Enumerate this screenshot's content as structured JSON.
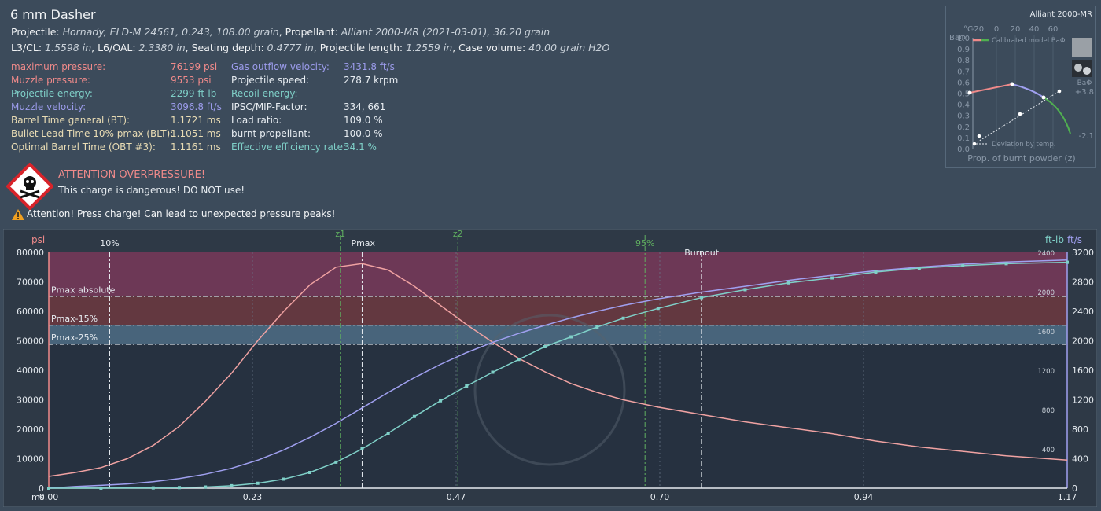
{
  "header": {
    "title": "6 mm Dasher",
    "line1": [
      {
        "t": "Projectile: ",
        "i": false
      },
      {
        "t": "Hornady, ELD-M 24561, 0.243, 108.00 grain",
        "i": true
      },
      {
        "t": ", Propellant: ",
        "i": false
      },
      {
        "t": "Alliant 2000-MR (2021-03-01), 36.20 grain",
        "i": true
      }
    ],
    "line2": [
      {
        "t": "L3/CL: ",
        "i": false
      },
      {
        "t": "1.5598 in",
        "i": true
      },
      {
        "t": ", L6/OAL: ",
        "i": false
      },
      {
        "t": "2.3380 in",
        "i": true
      },
      {
        "t": ", Seating depth: ",
        "i": false
      },
      {
        "t": "0.4777 in",
        "i": true
      },
      {
        "t": ", Projectile length: ",
        "i": false
      },
      {
        "t": "1.2559 in",
        "i": true
      },
      {
        "t": ", Case volume: ",
        "i": false
      },
      {
        "t": "40.00 grain H2O",
        "i": true
      }
    ]
  },
  "results_left": [
    {
      "label": "maximum pressure:",
      "value": "76199 psi",
      "color": "red"
    },
    {
      "label": "Muzzle pressure:",
      "value": "9553 psi",
      "color": "red"
    },
    {
      "label": "Projectile energy:",
      "value": "2299 ft-lb",
      "color": "teal"
    },
    {
      "label": "Muzzle velocity:",
      "value": "3096.8 ft/s",
      "color": "blue"
    },
    {
      "label": "Barrel Time general (BT):",
      "value": "1.1721 ms",
      "color": "beige"
    },
    {
      "label": "Bullet Lead Time 10% pmax (BLT):",
      "value": "1.1051 ms",
      "color": "beige"
    },
    {
      "label": "Optimal Barrel Time (OBT #3):",
      "value": "1.1161 ms",
      "color": "beige"
    }
  ],
  "results_right": [
    {
      "label": "Gas outflow velocity:",
      "value": "3431.8 ft/s",
      "color": "blue"
    },
    {
      "label": "Projectile speed:",
      "value": "278.7 krpm",
      "color": "white"
    },
    {
      "label": "Recoil energy:",
      "value": "-",
      "color": "teal"
    },
    {
      "label": "IPSC/MIP-Factor:",
      "value": "334, 661",
      "color": "white"
    },
    {
      "label": "Load ratio:",
      "value": "109.0 %",
      "color": "white"
    },
    {
      "label": "burnt propellant:",
      "value": "100.0 %",
      "color": "white"
    },
    {
      "label": "Effective efficiency rate:",
      "value": "34.1 %",
      "color": "teal"
    }
  ],
  "warnings": {
    "overpressure_title": "ATTENTION OVERPRESSURE!",
    "overpressure_text": "This charge is dangerous! DO NOT use!",
    "press_charge": "Attention! Press charge! Can lead to unexpected pressure peaks!"
  },
  "inset": {
    "title": "Alliant 2000-MR",
    "y_label": "BaΦ",
    "top_axis_label": "°C",
    "top_axis_ticks": [
      "-20",
      "0",
      "20",
      "40",
      "60"
    ],
    "y_ticks": [
      "1.0",
      "0.9",
      "0.8",
      "0.7",
      "0.6",
      "0.5",
      "0.4",
      "0.3",
      "0.2",
      "0.1",
      "0.0"
    ],
    "right_ticks": [
      "+3.8",
      "-2.1"
    ],
    "legend_calibrated": "Calibrated model BaΦ",
    "legend_deviation": "Deviation by temp.",
    "x_label": "Prop. of burnt powder (z)",
    "side_label": "BaΦ"
  },
  "chart_data": {
    "type": "line",
    "x_unit": "ms",
    "x_ticks": [
      "0.00",
      "0.23",
      "0.47",
      "0.70",
      "0.94",
      "1.17"
    ],
    "x_range": [
      0,
      1.17
    ],
    "y_left_unit": "psi",
    "y_left_ticks": [
      "0",
      "10000",
      "20000",
      "30000",
      "40000",
      "50000",
      "60000",
      "70000",
      "80000"
    ],
    "y_left_range": [
      0,
      80000
    ],
    "y_right_velocity_unit": "ft/s",
    "y_right_velocity_ticks": [
      "0",
      "400",
      "800",
      "1200",
      "1600",
      "2000",
      "2400",
      "2800",
      "3200"
    ],
    "y_right_velocity_range": [
      0,
      3200
    ],
    "y_right_energy_unit": "ft-lb",
    "y_right_energy_ticks": [
      "400",
      "800",
      "1200",
      "1600",
      "2000",
      "2400"
    ],
    "y_right_energy_range": [
      0,
      2400
    ],
    "markers": [
      {
        "label": "10%",
        "x": 0.07,
        "style": "white"
      },
      {
        "label": "z1",
        "x": 0.335,
        "style": "green"
      },
      {
        "label": "Pmax",
        "x": 0.36,
        "style": "white"
      },
      {
        "label": "z2",
        "x": 0.47,
        "style": "green"
      },
      {
        "label": "95%",
        "x": 0.685,
        "style": "green"
      },
      {
        "label": "Burnout",
        "x": 0.75,
        "style": "white"
      }
    ],
    "zones": [
      {
        "label": "Pmax absolute",
        "value": 65000,
        "color": "#7a3a5a"
      },
      {
        "label": "Pmax-15%",
        "value": 55250,
        "color": "#6a3a40"
      },
      {
        "label": "Pmax-25%",
        "value": 48750,
        "color": "#4d6a82"
      }
    ],
    "series": [
      {
        "name": "pressure",
        "unit": "psi",
        "color": "#f0a2a2",
        "points": [
          [
            0,
            4000
          ],
          [
            0.03,
            5300
          ],
          [
            0.06,
            7000
          ],
          [
            0.09,
            10000
          ],
          [
            0.12,
            14500
          ],
          [
            0.15,
            21000
          ],
          [
            0.18,
            29500
          ],
          [
            0.21,
            39000
          ],
          [
            0.24,
            50000
          ],
          [
            0.27,
            60000
          ],
          [
            0.3,
            69000
          ],
          [
            0.33,
            75000
          ],
          [
            0.36,
            76199
          ],
          [
            0.39,
            74000
          ],
          [
            0.42,
            68500
          ],
          [
            0.45,
            62000
          ],
          [
            0.48,
            55500
          ],
          [
            0.51,
            49500
          ],
          [
            0.54,
            44000
          ],
          [
            0.57,
            39500
          ],
          [
            0.6,
            35500
          ],
          [
            0.63,
            32500
          ],
          [
            0.66,
            30000
          ],
          [
            0.7,
            27500
          ],
          [
            0.75,
            25000
          ],
          [
            0.8,
            22500
          ],
          [
            0.85,
            20500
          ],
          [
            0.9,
            18500
          ],
          [
            0.95,
            16000
          ],
          [
            1.0,
            14000
          ],
          [
            1.05,
            12500
          ],
          [
            1.1,
            11000
          ],
          [
            1.17,
            9553
          ]
        ]
      },
      {
        "name": "velocity",
        "unit": "ft/s",
        "color": "#a0a0f0",
        "points": [
          [
            0,
            0
          ],
          [
            0.03,
            22
          ],
          [
            0.06,
            38
          ],
          [
            0.09,
            58
          ],
          [
            0.12,
            88
          ],
          [
            0.15,
            130
          ],
          [
            0.18,
            190
          ],
          [
            0.21,
            270
          ],
          [
            0.24,
            380
          ],
          [
            0.27,
            520
          ],
          [
            0.3,
            690
          ],
          [
            0.33,
            880
          ],
          [
            0.36,
            1090
          ],
          [
            0.39,
            1300
          ],
          [
            0.42,
            1500
          ],
          [
            0.45,
            1680
          ],
          [
            0.48,
            1840
          ],
          [
            0.51,
            1980
          ],
          [
            0.54,
            2100
          ],
          [
            0.57,
            2210
          ],
          [
            0.6,
            2310
          ],
          [
            0.63,
            2400
          ],
          [
            0.66,
            2480
          ],
          [
            0.7,
            2570
          ],
          [
            0.75,
            2660
          ],
          [
            0.8,
            2740
          ],
          [
            0.85,
            2820
          ],
          [
            0.9,
            2890
          ],
          [
            0.95,
            2950
          ],
          [
            1.0,
            3000
          ],
          [
            1.05,
            3040
          ],
          [
            1.1,
            3070
          ],
          [
            1.17,
            3097
          ]
        ]
      },
      {
        "name": "energy",
        "unit": "ft-lb",
        "color": "#7fd0c8",
        "points": [
          [
            0,
            0
          ],
          [
            0.06,
            0.5
          ],
          [
            0.12,
            3
          ],
          [
            0.15,
            6
          ],
          [
            0.18,
            12
          ],
          [
            0.21,
            25
          ],
          [
            0.24,
            50
          ],
          [
            0.27,
            92
          ],
          [
            0.3,
            160
          ],
          [
            0.33,
            265
          ],
          [
            0.36,
            400
          ],
          [
            0.39,
            560
          ],
          [
            0.42,
            730
          ],
          [
            0.45,
            890
          ],
          [
            0.48,
            1040
          ],
          [
            0.51,
            1180
          ],
          [
            0.54,
            1310
          ],
          [
            0.57,
            1440
          ],
          [
            0.6,
            1540
          ],
          [
            0.63,
            1640
          ],
          [
            0.66,
            1730
          ],
          [
            0.7,
            1830
          ],
          [
            0.75,
            1940
          ],
          [
            0.8,
            2020
          ],
          [
            0.85,
            2090
          ],
          [
            0.9,
            2140
          ],
          [
            0.95,
            2200
          ],
          [
            1.0,
            2240
          ],
          [
            1.05,
            2265
          ],
          [
            1.1,
            2285
          ],
          [
            1.17,
            2299
          ]
        ]
      }
    ]
  }
}
